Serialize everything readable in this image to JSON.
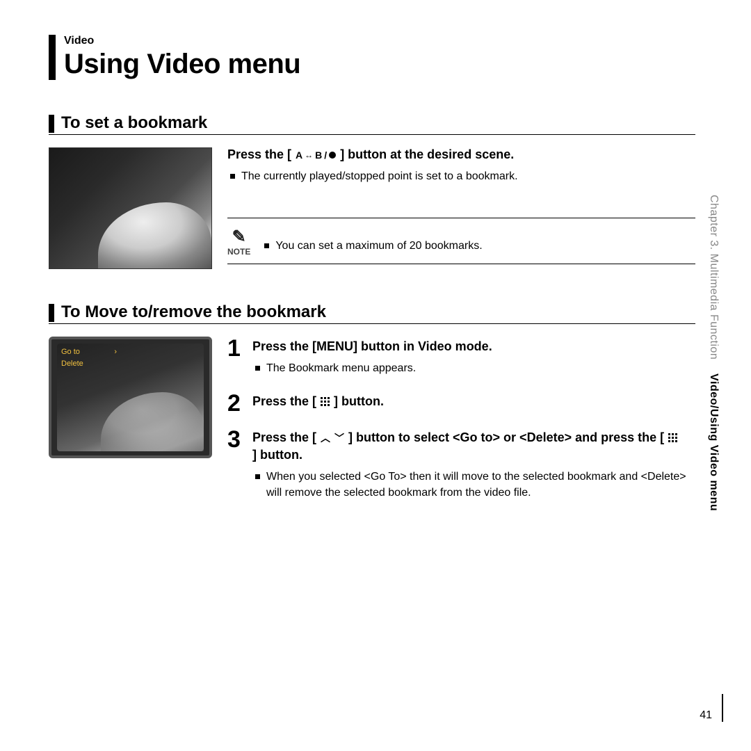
{
  "header": {
    "category": "Video",
    "title": "Using Video menu"
  },
  "section1": {
    "title": "To set a bookmark",
    "press_pre": "Press the [",
    "press_post": "] button at the desired scene.",
    "bullet1": "The currently played/stopped point is set to a bookmark.",
    "note_label": "NOTE",
    "note_bullet": "You can set a maximum of 20 bookmarks."
  },
  "section2": {
    "title": "To Move to/remove the bookmark",
    "thumb_goto": "Go to",
    "thumb_delete": "Delete",
    "step1_instr": "Press the [MENU] button in Video mode.",
    "step1_bullet": "The Bookmark menu appears.",
    "step2_pre": "Press the [",
    "step2_post": "] button.",
    "step3_pre": "Press the [",
    "step3_mid": "] button to select <Go to> or <Delete> and press the [",
    "step3_post": "] button.",
    "step3_bullet": "When you selected <Go To> then it will move to the selected bookmark and <Delete> will remove the selected bookmark from the video file."
  },
  "sidebar": {
    "chapter": "Chapter 3. Multimedia Function",
    "current": "Video/Using Video menu"
  },
  "page_number": "41",
  "nums": {
    "n1": "1",
    "n2": "2",
    "n3": "3"
  },
  "ab": {
    "a": "A",
    "b": "B",
    "slash": "/"
  }
}
